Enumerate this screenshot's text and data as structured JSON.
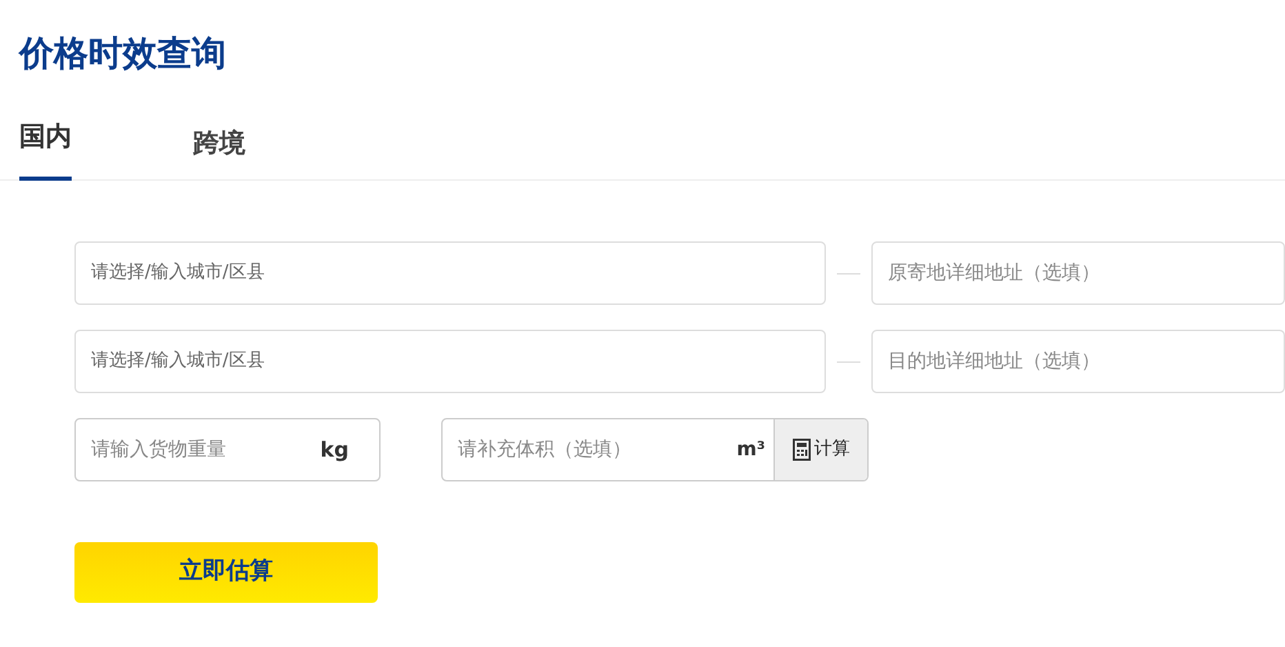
{
  "title": "价格时效查询",
  "tabs": [
    {
      "label": "国内",
      "selected": true
    },
    {
      "label": "跨境",
      "selected": false
    }
  ],
  "origin": {
    "city_placeholder": "请选择/输入城市/区县",
    "address_placeholder": "原寄地详细地址（选填）"
  },
  "destination": {
    "city_placeholder": "请选择/输入城市/区县",
    "address_placeholder": "目的地详细地址（选填）"
  },
  "weight": {
    "placeholder": "请输入货物重量",
    "unit": "kg"
  },
  "volume": {
    "placeholder": "请补充体积（选填）",
    "unit": "m³",
    "calc_button": "计算"
  },
  "submit_button": "立即估算"
}
